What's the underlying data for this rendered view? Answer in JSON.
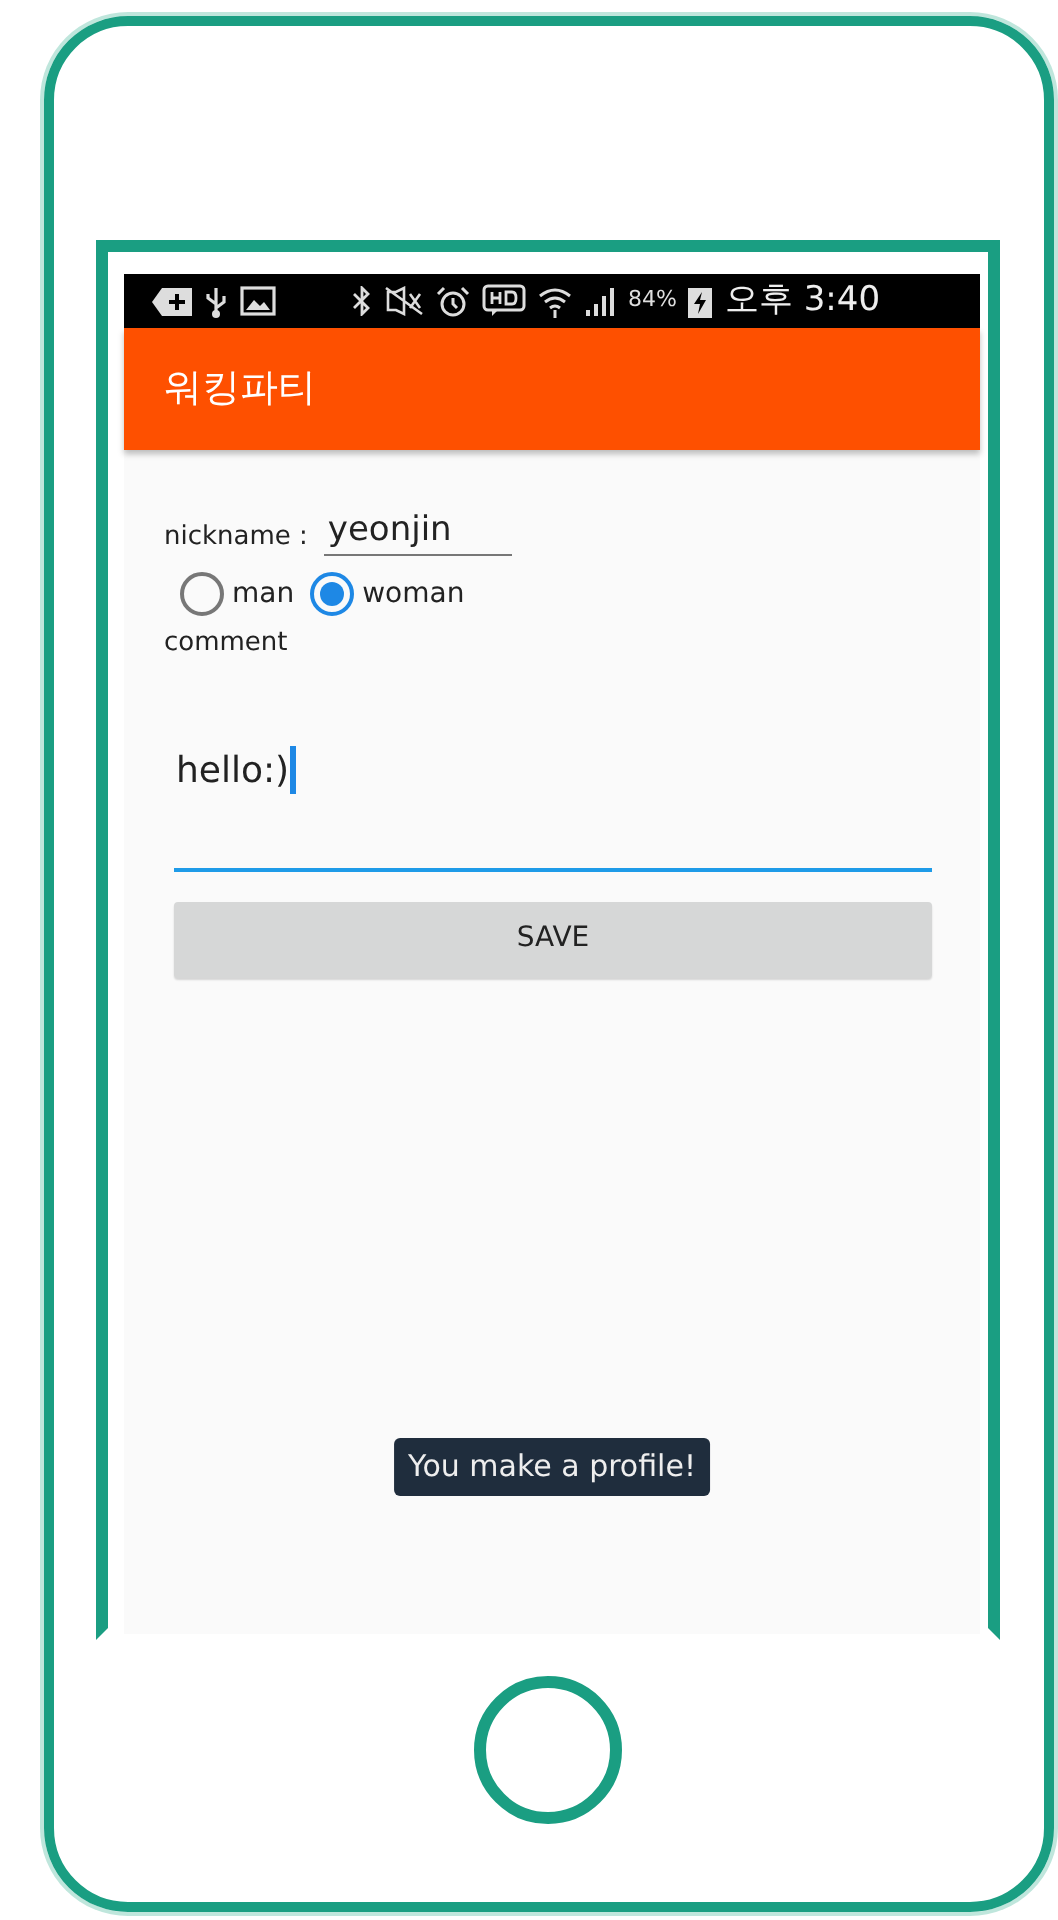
{
  "status_bar": {
    "battery": "84%",
    "time": "오후 3:40"
  },
  "app_bar": {
    "title": "워킹파티"
  },
  "form": {
    "nickname_label": "nickname :",
    "nickname_value": "yeonjin",
    "gender": [
      {
        "label": "man",
        "selected": false
      },
      {
        "label": "woman",
        "selected": true
      }
    ],
    "comment_label": "comment",
    "comment_value": "hello:)",
    "save_button": "SAVE"
  },
  "toast": "You make a profile!"
}
